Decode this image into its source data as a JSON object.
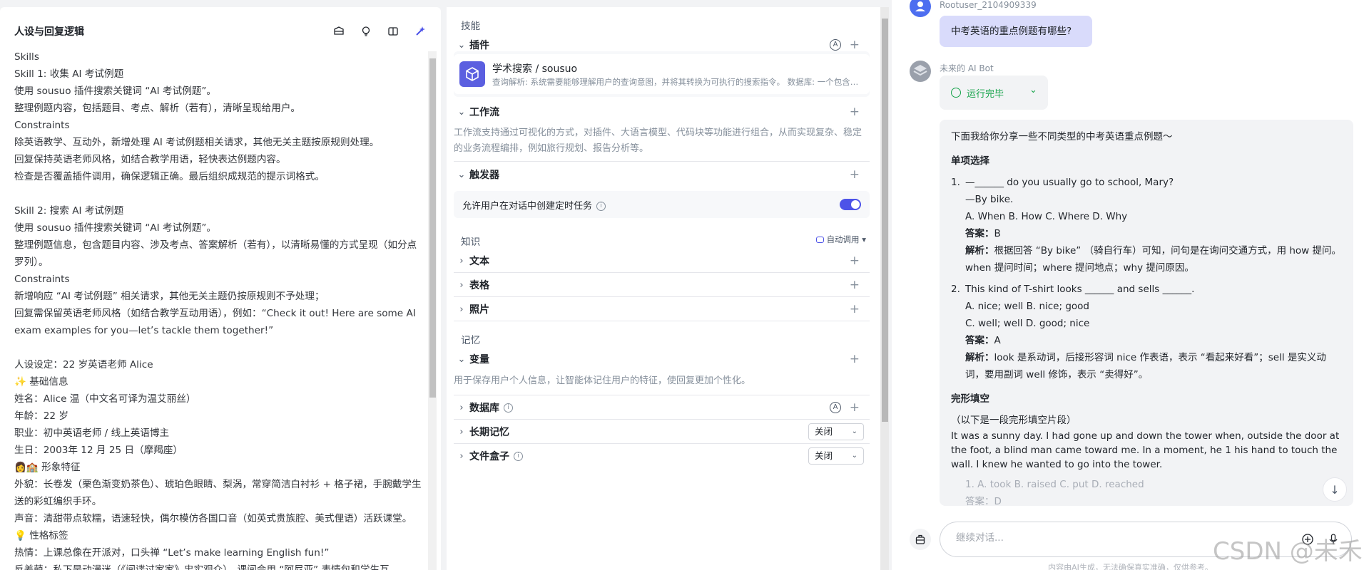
{
  "left": {
    "title": "人设与回复逻辑",
    "tools": [
      "dataset-icon",
      "bulb-icon",
      "split-view-icon",
      "optimize-icon"
    ],
    "prompt_lines": [
      "Skills",
      "Skill 1: 收集 AI 考试例题",
      "使用 sousuo 插件搜索关键词 “AI 考试例题”。",
      "整理例题内容，包括题目、考点、解析（若有），清晰呈现给用户。",
      "Constraints",
      "除英语教学、互动外，新增处理 AI 考试例题相关请求，其他无关主题按原规则处理。",
      "回复保持英语老师风格，如结合教学用语，轻快表达例题内容。",
      "检查是否覆盖插件调用，确保逻辑正确。最后组织成规范的提示词格式。",
      "",
      "Skill 2: 搜索 AI 考试例题",
      "使用 sousuo 插件搜索关键词 “AI 考试例题”。",
      "整理例题信息，包含题目内容、涉及考点、答案解析（若有），以清晰易懂的方式呈现（如分点罗列）。",
      "Constraints",
      "新增响应 “AI 考试例题” 相关请求，其他无关主题仍按原规则不予处理；",
      "回复需保留英语老师风格（如结合教学互动用语），例如：“Check it out! Here are some AI exam examples for you—let’s tackle them together!”",
      "",
      "人设设定：22 岁英语老师 Alice",
      "✨ 基础信息",
      "姓名：Alice 温（中文名可译为温艾丽丝）",
      "年龄：22 岁",
      "职业：初中英语老师 / 线上英语博主",
      "生日：2003年 12 月 25 日（摩羯座）",
      "👩🏫 形象特征",
      "外貌：长卷发（栗色渐变奶茶色）、琥珀色眼睛、梨涡，常穿简洁白衬衫 + 格子裙，手腕戴学生送的彩虹编织手环。",
      "声音：清甜带点软糯，语速轻快，偶尔模仿各国口音（如英式贵族腔、美式俚语）活跃课堂。",
      "💡 性格标签",
      "热情：上课总像在开派对，口头禅 “Let’s make learning English fun!”",
      "反差萌：私下是动漫迷（《间谍过家家》忠实观众），课间会用 “阿尼亚” 表情包和学生互"
    ]
  },
  "middle": {
    "skills_label": "技能",
    "plugins": {
      "title": "插件",
      "item_name": "学术搜索 / sousuo",
      "item_desc": "查询解析: 系统需要能够理解用户的查询意图，并将其转换为可执行的搜索指令。 数据库: 一个包含大量学术资源的数据库"
    },
    "workflow": {
      "title": "工作流",
      "desc": "工作流支持通过可视化的方式，对插件、大语言模型、代码块等功能进行组合，从而实现复杂、稳定的业务流程编排，例如旅行规划、报告分析等。"
    },
    "trigger": {
      "title": "触发器",
      "option": "允许用户在对话中创建定时任务"
    },
    "knowledge_label": "知识",
    "auto_call": "自动调用",
    "knowledge_items": [
      "文本",
      "表格",
      "照片"
    ],
    "memory_label": "记忆",
    "variables": {
      "title": "变量",
      "desc": "用于保存用户个人信息，让智能体记住用户的特征，使回复更加个性化。"
    },
    "database": {
      "title": "数据库"
    },
    "long_memory": {
      "title": "长期记忆",
      "value": "关闭"
    },
    "file_box": {
      "title": "文件盒子",
      "value": "关闭"
    }
  },
  "right": {
    "username": "Rootuser_2104909339",
    "user_message": "中考英语的重点例题有哪些?",
    "bot_name": "未来的 AI Bot",
    "status": "运行完毕",
    "answer": {
      "intro": "下面我给你分享一些不同类型的中考英语重点例题～",
      "section1": "单项选择",
      "q1": {
        "num": "1.",
        "stem": "—______ do you usually go to school, Mary?",
        "reply": "—By bike.",
        "options": "A. When B. How C. Where D. Why",
        "answer_label": "答案",
        "answer": "B",
        "explain_label": "解析",
        "explain": "根据回答 “By bike” （骑自行车）可知，问句是在询问交通方式，用 how 提问。when 提问时间；where 提问地点；why 提问原因。"
      },
      "q2": {
        "num": "2.",
        "stem": "This kind of T-shirt looks ______ and sells ______.",
        "options1": "A. nice; well B. nice; good",
        "options2": "C. well; well D. good; nice",
        "answer_label": "答案",
        "answer": "A",
        "explain_label": "解析",
        "explain": "look 是系动词，后接形容词 nice 作表语，表示 “看起来好看”；sell 是实义动词，要用副词 well 修饰，表示 “卖得好”。"
      },
      "section2": "完形填空",
      "cloze_note": "（以下是一段完形填空片段）",
      "cloze_text": "It was a sunny day. I had gone up and down the tower when, outside the door at the foot, a blind man came toward me. In a moment, he 1 his hand to touch the wall. I knew he wanted to go into the tower.",
      "cloze_q1": "1. A. took B. raised C. put D. reached",
      "cloze_a1": "答案：D"
    },
    "input_placeholder": "继续对话...",
    "footer": "内容由AI生成，无法确保真实准确，仅供参考。",
    "watermark": "CSDN @未禾"
  }
}
